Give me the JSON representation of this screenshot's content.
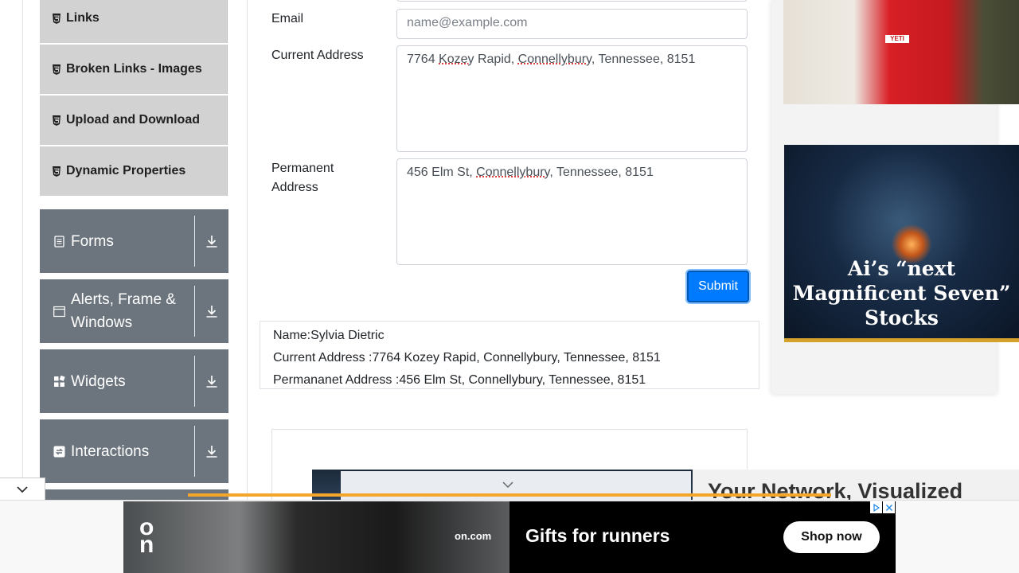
{
  "sidebar": {
    "sub_items": [
      {
        "label": "Links"
      },
      {
        "label": "Broken Links - Images"
      },
      {
        "label": "Upload and Download"
      },
      {
        "label": "Dynamic Properties"
      }
    ],
    "groups": [
      {
        "label": "Forms",
        "icon": "document-icon"
      },
      {
        "label": "Alerts, Frame & Windows",
        "icon": "window-icon"
      },
      {
        "label": "Widgets",
        "icon": "widgets-icon"
      },
      {
        "label": "Interactions",
        "icon": "interactions-icon"
      }
    ]
  },
  "form": {
    "email_label": "Email",
    "email_placeholder": "name@example.com",
    "current_address_label": "Current Address",
    "current_address_parts": [
      "7764 ",
      "Kozey",
      " Rapid, ",
      "Connellybury",
      ", Tennessee, 8151"
    ],
    "permanent_address_label": "Permanent Address",
    "permanent_address_parts": [
      "456 Elm St, ",
      "Connellybury",
      ", Tennessee, 8151"
    ],
    "submit_label": "Submit"
  },
  "output": {
    "name": "Name:Sylvia Dietric",
    "current_address": "Current Address :7764 Kozey Rapid, Connellybury, Tennessee, 8151",
    "permanent_address": "Permananet Address :456 Elm St, Connellybury, Tennessee, 8151"
  },
  "ads": {
    "right_top_brand": "YETI",
    "right_ai_headline": "Ai’s “next Magnificent Seven” Stocks",
    "network_title": "Your Network, Visualized",
    "banner_brand": "on.com",
    "banner_headline": "Gifts for runners",
    "banner_cta": "Shop now"
  },
  "colors": {
    "sidebar_group_bg": "#6c757d",
    "sidebar_subitem_bg": "#d2d2d2",
    "submit_bg": "#007bff",
    "accent_orange": "#f4a62a"
  }
}
